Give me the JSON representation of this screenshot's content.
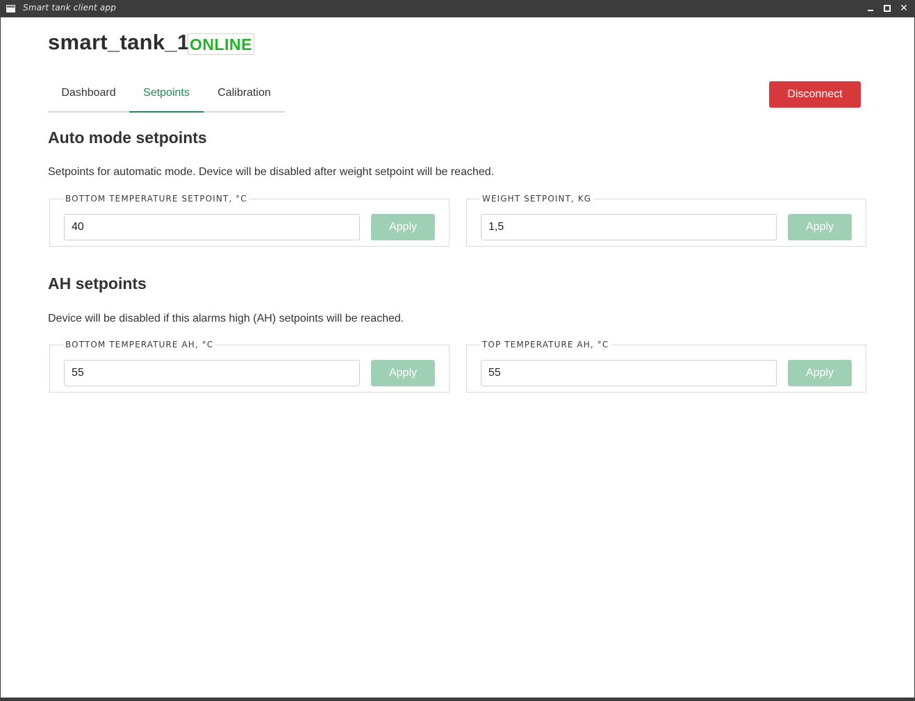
{
  "window": {
    "title": "Smart tank client app",
    "close_glyph": "✕"
  },
  "header": {
    "device_name": "smart_tank_1",
    "status": "ONLINE",
    "status_color": "#21b527",
    "disconnect_label": "Disconnect"
  },
  "tabs": [
    {
      "label": "Dashboard",
      "active": false
    },
    {
      "label": "Setpoints",
      "active": true
    },
    {
      "label": "Calibration",
      "active": false
    }
  ],
  "auto_mode": {
    "title": "Auto mode setpoints",
    "description": "Setpoints for automatic mode. Device will be disabled after weight setpoint will be reached.",
    "cards": [
      {
        "legend": "BOTTOM TEMPERATURE SETPOINT, °C",
        "value": "40",
        "apply_label": "Apply"
      },
      {
        "legend": "WEIGHT SETPOINT, KG",
        "value": "1,5",
        "apply_label": "Apply"
      }
    ]
  },
  "ah": {
    "title": "AH setpoints",
    "description": "Device will be disabled if this alarms high (AH) setpoints will be reached.",
    "cards": [
      {
        "legend": "BOTTOM TEMPERATURE AH, °C",
        "value": "55",
        "apply_label": "Apply"
      },
      {
        "legend": "TOP TEMPERATURE AH, °C",
        "value": "55",
        "apply_label": "Apply"
      }
    ]
  },
  "colors": {
    "accent": "#1f8a4c",
    "disconnect": "#d6393b",
    "apply_disabled": "#9fcfb5"
  }
}
